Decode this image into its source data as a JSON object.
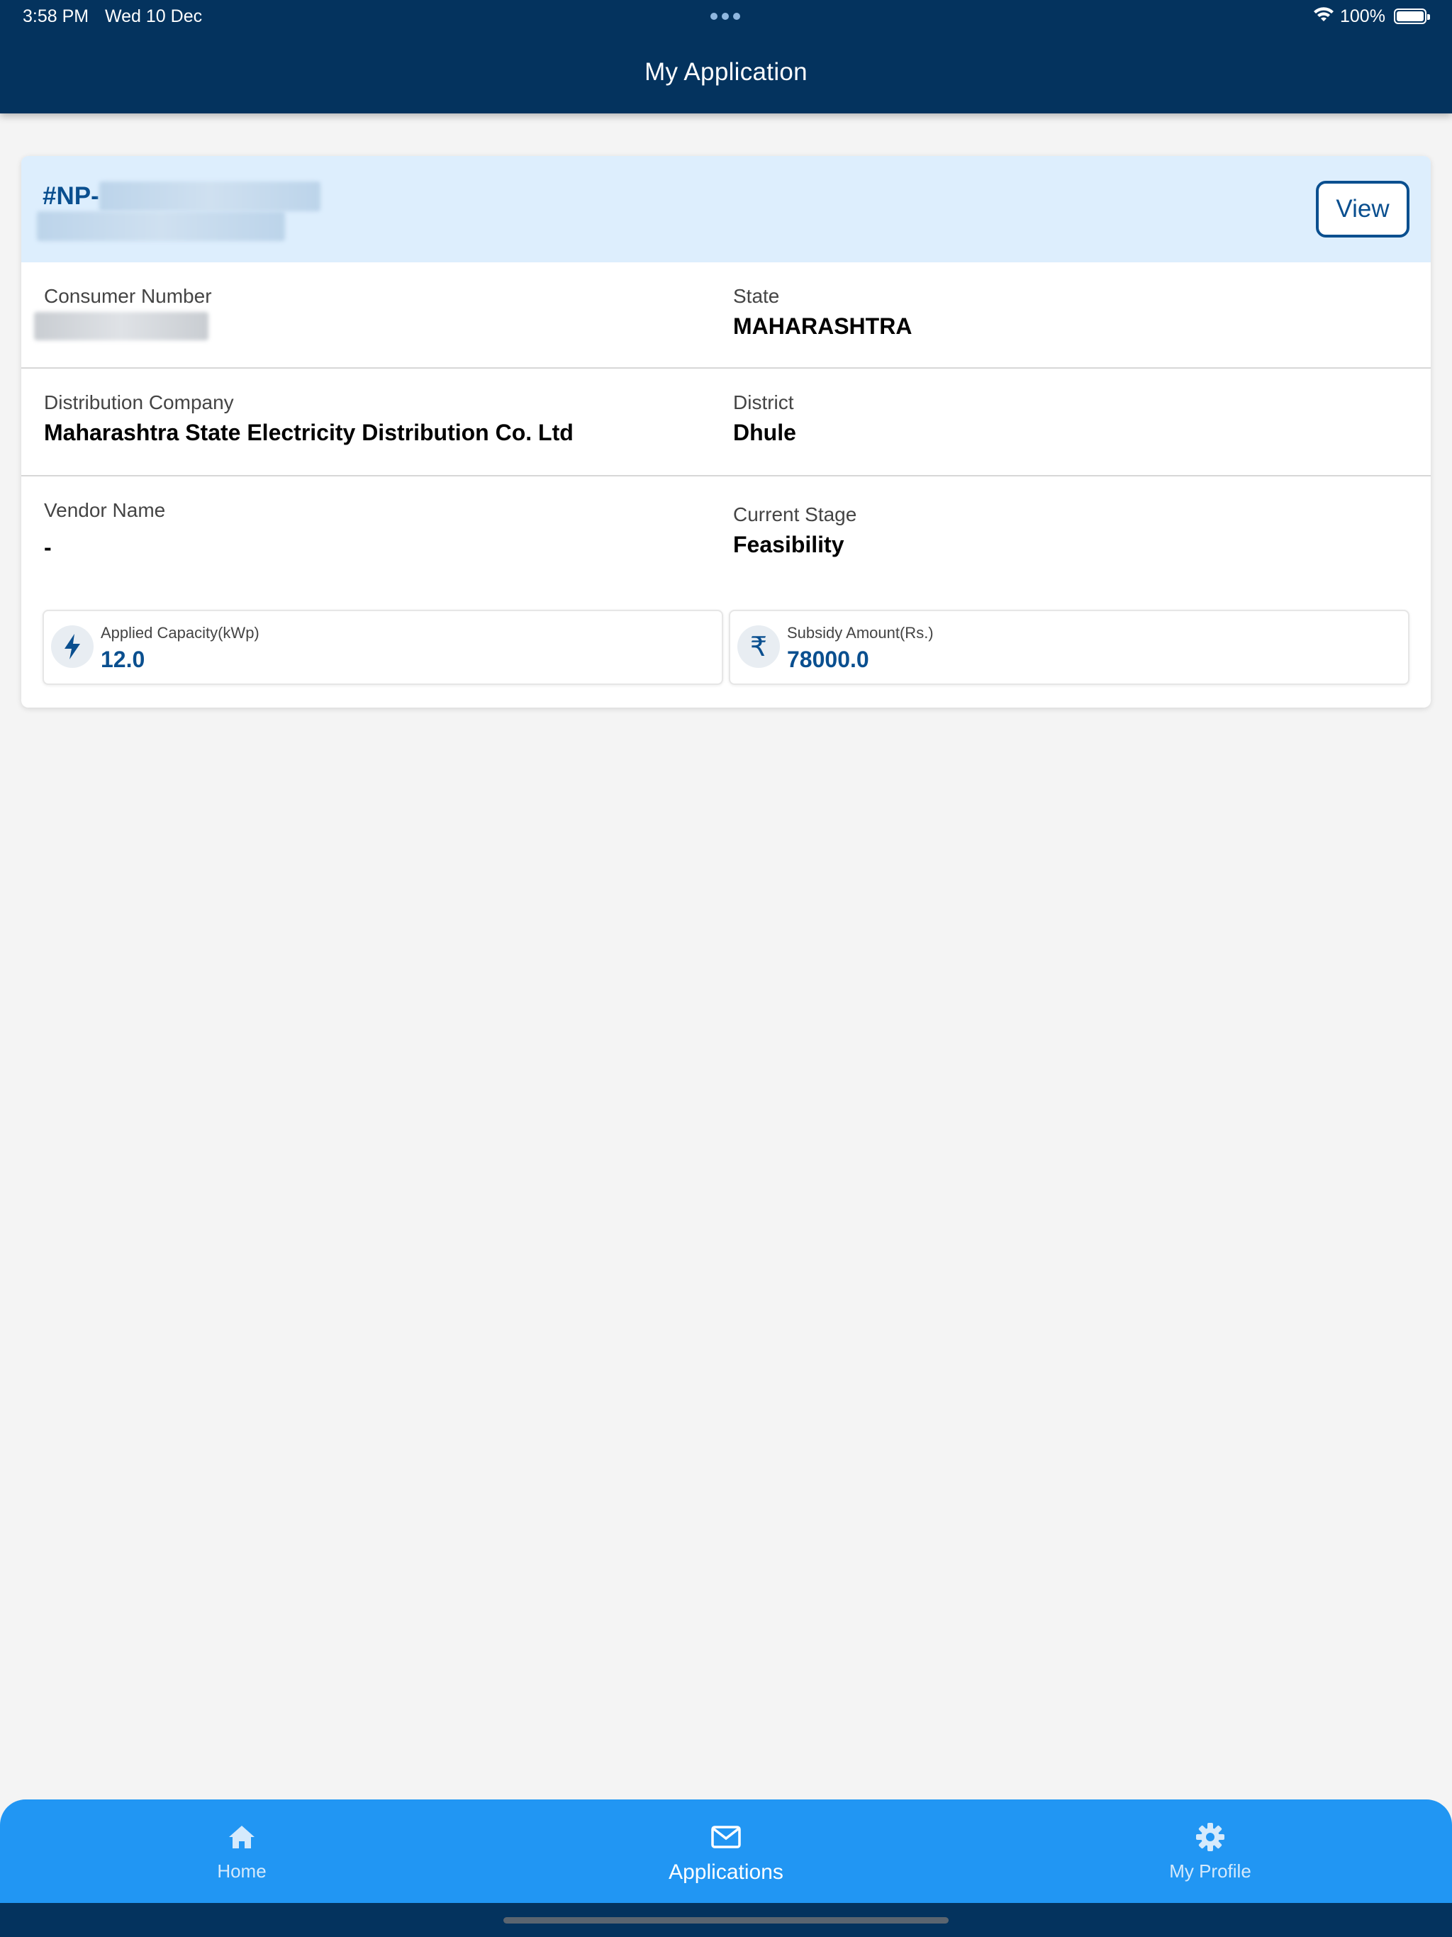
{
  "status_bar": {
    "time": "3:58 PM",
    "date": "Wed 10 Dec",
    "battery": "100%"
  },
  "header": {
    "title": "My Application"
  },
  "application": {
    "id_prefix": "#NP-",
    "view_label": "View",
    "fields": {
      "consumer_number_label": "Consumer Number",
      "state_label": "State",
      "state_value": "MAHARASHTRA",
      "distribution_company_label": "Distribution Company",
      "distribution_company_value": "Maharashtra State Electricity Distribution Co. Ltd",
      "district_label": "District",
      "district_value": "Dhule",
      "vendor_name_label": "Vendor Name",
      "vendor_name_value": "-",
      "current_stage_label": "Current Stage",
      "current_stage_value": "Feasibility"
    },
    "stats": {
      "capacity_label": "Applied Capacity(kWp)",
      "capacity_value": "12.0",
      "subsidy_label": "Subsidy Amount(Rs.)",
      "subsidy_value": "78000.0"
    }
  },
  "bottom_nav": {
    "items": [
      {
        "label": "Home",
        "icon": "home-icon"
      },
      {
        "label": "Applications",
        "icon": "mail-icon"
      },
      {
        "label": "My Profile",
        "icon": "gear-icon"
      }
    ]
  },
  "colors": {
    "header": "#04335e",
    "accent": "#0a4f8f",
    "nav": "#2196f3",
    "card_head": "#ddeefd"
  }
}
